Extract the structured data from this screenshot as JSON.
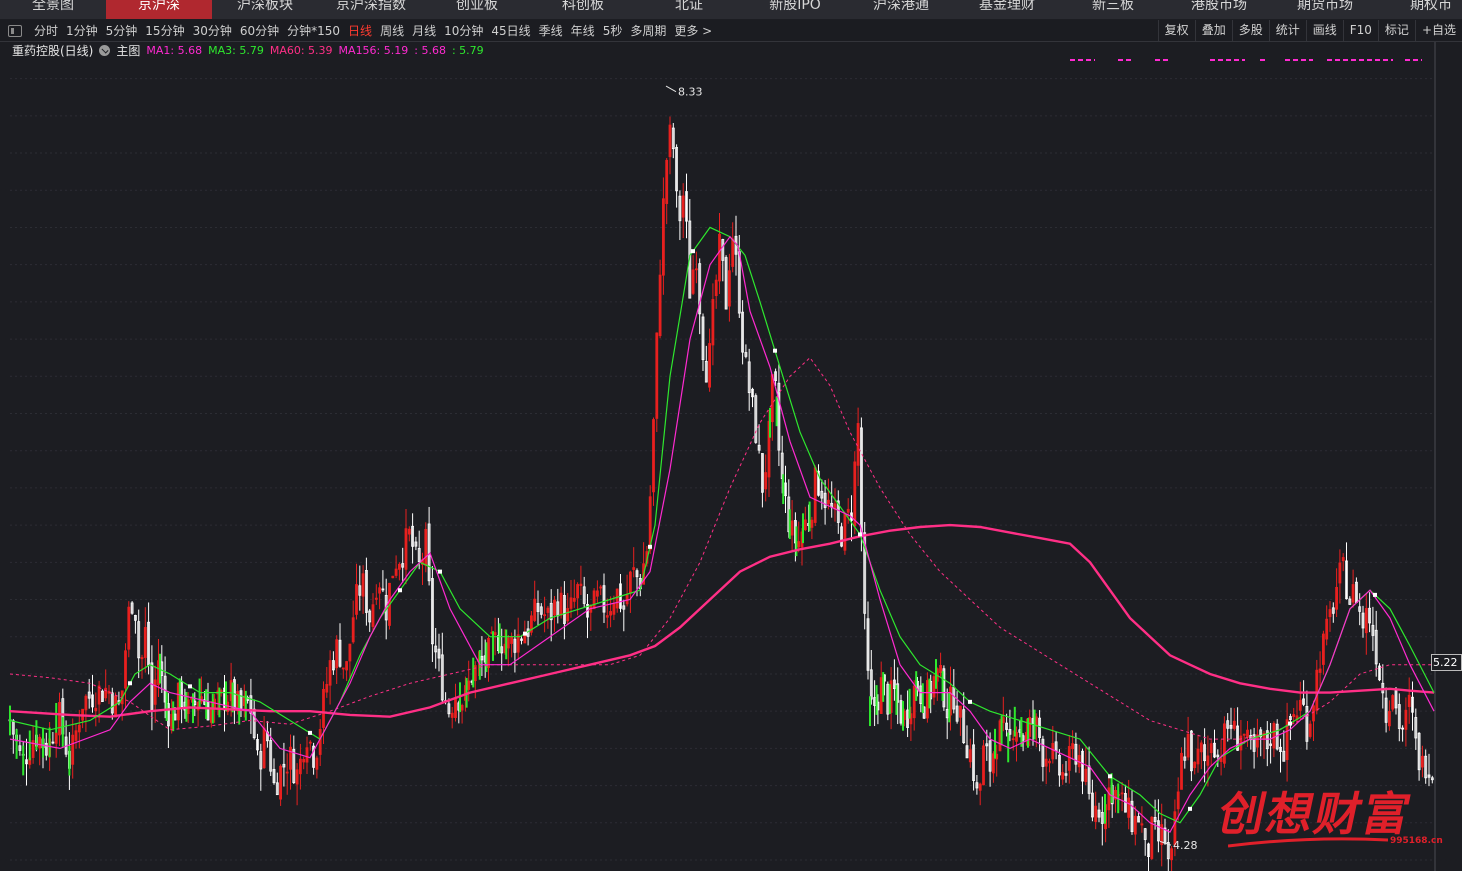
{
  "nav": {
    "tabs": [
      "全景图",
      "京沪深",
      "沪深板块",
      "京沪深指数",
      "创业板",
      "科创板",
      "北证",
      "新股IPO",
      "沪深港通",
      "基金理财",
      "新三板",
      "港股市场",
      "期货市场",
      "期权市"
    ],
    "active": 1
  },
  "toolbar": {
    "periods": [
      "分时",
      "1分钟",
      "5分钟",
      "15分钟",
      "30分钟",
      "60分钟",
      "分钟*150",
      "日线",
      "周线",
      "月线",
      "10分钟",
      "45日线",
      "季线",
      "年线",
      "5秒",
      "多周期",
      "更多 >"
    ],
    "active_period": "日线",
    "tools": [
      "复权",
      "叠加",
      "多股",
      "统计",
      "画线",
      "F10",
      "标记",
      "+自选"
    ]
  },
  "legend": {
    "title": "重药控股(日线)",
    "main": "主图",
    "items": [
      {
        "label": "MA1: 5.68",
        "color": "#ff2ad1"
      },
      {
        "label": "MA3: 5.79",
        "color": "#2ee82e"
      },
      {
        "label": "MA60: 5.39",
        "color": "#ff2f86"
      },
      {
        "label": "MA156: 5.19",
        "color": "#ff2ad1"
      },
      {
        "label": ": 5.68",
        "color": "#ff2ad1"
      },
      {
        "label": ": 5.79",
        "color": "#2ee82e"
      }
    ]
  },
  "price_tag": "5.22",
  "watermark": {
    "text": "创想财富",
    "url": "995168.cn"
  },
  "chart_data": {
    "type": "candlestick",
    "high_label": "8.33",
    "low_label": "4.28",
    "ylim": [
      4.2,
      8.5
    ],
    "last_close": 5.22,
    "colors": {
      "up": "#e8201f",
      "down": "#ffffff",
      "ma_fast": "#ff2ad1",
      "ma_mid": "#2ee82e",
      "ma_long": "#ff2f86",
      "ma_dash": "#ff2f86"
    },
    "close_path": [
      [
        0,
        4.95
      ],
      [
        12,
        4.72
      ],
      [
        25,
        4.88
      ],
      [
        38,
        4.8
      ],
      [
        48,
        5.0
      ],
      [
        60,
        4.72
      ],
      [
        72,
        5.05
      ],
      [
        85,
        5.1
      ],
      [
        98,
        5.12
      ],
      [
        108,
        5.0
      ],
      [
        112,
        5.1
      ],
      [
        118,
        5.5
      ],
      [
        124,
        5.65
      ],
      [
        130,
        5.2
      ],
      [
        136,
        5.45
      ],
      [
        142,
        5.0
      ],
      [
        148,
        5.3
      ],
      [
        155,
        5.05
      ],
      [
        162,
        4.95
      ],
      [
        170,
        5.1
      ],
      [
        180,
        4.98
      ],
      [
        190,
        5.1
      ],
      [
        200,
        5.0
      ],
      [
        210,
        5.05
      ],
      [
        220,
        5.1
      ],
      [
        230,
        5.0
      ],
      [
        240,
        5.05
      ],
      [
        248,
        4.7
      ],
      [
        256,
        4.9
      ],
      [
        264,
        4.6
      ],
      [
        272,
        4.7
      ],
      [
        280,
        4.75
      ],
      [
        288,
        4.65
      ],
      [
        296,
        4.9
      ],
      [
        305,
        4.75
      ],
      [
        312,
        5.0
      ],
      [
        320,
        5.25
      ],
      [
        328,
        5.35
      ],
      [
        336,
        5.2
      ],
      [
        344,
        5.55
      ],
      [
        352,
        5.7
      ],
      [
        360,
        5.5
      ],
      [
        368,
        5.75
      ],
      [
        376,
        5.55
      ],
      [
        384,
        5.8
      ],
      [
        392,
        5.85
      ],
      [
        400,
        5.95
      ],
      [
        408,
        5.75
      ],
      [
        416,
        5.9
      ],
      [
        422,
        5.4
      ],
      [
        430,
        5.2
      ],
      [
        438,
        5.0
      ],
      [
        446,
        5.1
      ],
      [
        454,
        5.05
      ],
      [
        462,
        5.2
      ],
      [
        470,
        5.25
      ],
      [
        478,
        5.3
      ],
      [
        488,
        5.4
      ],
      [
        498,
        5.35
      ],
      [
        508,
        5.4
      ],
      [
        518,
        5.45
      ],
      [
        528,
        5.55
      ],
      [
        538,
        5.5
      ],
      [
        548,
        5.6
      ],
      [
        558,
        5.5
      ],
      [
        568,
        5.65
      ],
      [
        578,
        5.5
      ],
      [
        588,
        5.6
      ],
      [
        598,
        5.55
      ],
      [
        606,
        5.65
      ],
      [
        614,
        5.55
      ],
      [
        622,
        5.75
      ],
      [
        630,
        5.7
      ],
      [
        638,
        5.9
      ],
      [
        644,
        6.6
      ],
      [
        650,
        7.4
      ],
      [
        656,
        7.95
      ],
      [
        662,
        8.15
      ],
      [
        668,
        7.6
      ],
      [
        674,
        7.8
      ],
      [
        680,
        7.25
      ],
      [
        686,
        7.5
      ],
      [
        692,
        7.0
      ],
      [
        698,
        6.8
      ],
      [
        704,
        7.2
      ],
      [
        710,
        7.5
      ],
      [
        716,
        7.2
      ],
      [
        722,
        7.6
      ],
      [
        728,
        7.3
      ],
      [
        734,
        6.9
      ],
      [
        740,
        6.7
      ],
      [
        746,
        6.5
      ],
      [
        752,
        6.2
      ],
      [
        758,
        6.4
      ],
      [
        764,
        6.85
      ],
      [
        770,
        6.3
      ],
      [
        776,
        6.1
      ],
      [
        782,
        5.95
      ],
      [
        788,
        5.9
      ],
      [
        794,
        6.0
      ],
      [
        800,
        6.05
      ],
      [
        806,
        6.25
      ],
      [
        812,
        6.2
      ],
      [
        818,
        6.1
      ],
      [
        824,
        6.05
      ],
      [
        830,
        5.95
      ],
      [
        836,
        6.0
      ],
      [
        842,
        6.1
      ],
      [
        848,
        6.55
      ],
      [
        854,
        5.5
      ],
      [
        860,
        5.0
      ],
      [
        866,
        5.05
      ],
      [
        872,
        5.15
      ],
      [
        878,
        5.05
      ],
      [
        884,
        5.1
      ],
      [
        890,
        5.0
      ],
      [
        896,
        4.95
      ],
      [
        902,
        5.1
      ],
      [
        908,
        5.15
      ],
      [
        914,
        5.05
      ],
      [
        920,
        5.1
      ],
      [
        926,
        5.2
      ],
      [
        932,
        5.15
      ],
      [
        938,
        5.0
      ],
      [
        944,
        5.1
      ],
      [
        950,
        4.95
      ],
      [
        956,
        4.85
      ],
      [
        962,
        4.75
      ],
      [
        968,
        4.5
      ],
      [
        974,
        4.8
      ],
      [
        980,
        4.7
      ],
      [
        986,
        4.85
      ],
      [
        992,
        4.9
      ],
      [
        998,
        4.8
      ],
      [
        1004,
        4.95
      ],
      [
        1010,
        4.9
      ],
      [
        1016,
        4.85
      ],
      [
        1022,
        4.95
      ],
      [
        1028,
        4.9
      ],
      [
        1034,
        4.75
      ],
      [
        1040,
        4.8
      ],
      [
        1046,
        4.7
      ],
      [
        1052,
        4.65
      ],
      [
        1058,
        4.7
      ],
      [
        1064,
        4.8
      ],
      [
        1070,
        4.75
      ],
      [
        1076,
        4.6
      ],
      [
        1082,
        4.45
      ],
      [
        1088,
        4.5
      ],
      [
        1094,
        4.45
      ],
      [
        1100,
        4.6
      ],
      [
        1106,
        4.55
      ],
      [
        1112,
        4.5
      ],
      [
        1118,
        4.45
      ],
      [
        1124,
        4.4
      ],
      [
        1130,
        4.45
      ],
      [
        1136,
        4.2
      ],
      [
        1142,
        4.35
      ],
      [
        1148,
        4.3
      ],
      [
        1154,
        4.35
      ],
      [
        1160,
        4.1
      ],
      [
        1166,
        4.45
      ],
      [
        1172,
        4.75
      ],
      [
        1178,
        4.85
      ],
      [
        1184,
        4.65
      ],
      [
        1190,
        4.8
      ],
      [
        1196,
        4.7
      ],
      [
        1202,
        4.9
      ],
      [
        1208,
        4.75
      ],
      [
        1214,
        4.85
      ],
      [
        1220,
        4.95
      ],
      [
        1226,
        4.85
      ],
      [
        1232,
        4.9
      ],
      [
        1238,
        4.8
      ],
      [
        1244,
        4.75
      ],
      [
        1250,
        4.85
      ],
      [
        1256,
        4.8
      ],
      [
        1262,
        4.9
      ],
      [
        1268,
        4.85
      ],
      [
        1274,
        4.8
      ],
      [
        1280,
        4.95
      ],
      [
        1286,
        5.0
      ],
      [
        1292,
        5.05
      ],
      [
        1298,
        4.9
      ],
      [
        1304,
        5.1
      ],
      [
        1310,
        5.3
      ],
      [
        1316,
        5.4
      ],
      [
        1322,
        5.55
      ],
      [
        1328,
        5.7
      ],
      [
        1334,
        5.75
      ],
      [
        1340,
        5.6
      ],
      [
        1346,
        5.65
      ],
      [
        1352,
        5.45
      ],
      [
        1358,
        5.55
      ],
      [
        1364,
        5.4
      ],
      [
        1370,
        5.2
      ],
      [
        1376,
        5.0
      ],
      [
        1382,
        5.15
      ],
      [
        1388,
        4.95
      ],
      [
        1394,
        4.9
      ],
      [
        1400,
        5.05
      ],
      [
        1406,
        4.8
      ],
      [
        1412,
        4.7
      ],
      [
        1418,
        4.75
      ],
      [
        1424,
        4.65
      ]
    ],
    "ma_fast_path": [
      [
        0,
        4.85
      ],
      [
        50,
        4.8
      ],
      [
        100,
        4.9
      ],
      [
        120,
        5.05
      ],
      [
        140,
        5.15
      ],
      [
        160,
        5.1
      ],
      [
        200,
        5.05
      ],
      [
        240,
        5.0
      ],
      [
        270,
        4.8
      ],
      [
        300,
        4.75
      ],
      [
        320,
        4.95
      ],
      [
        340,
        5.15
      ],
      [
        360,
        5.4
      ],
      [
        380,
        5.6
      ],
      [
        400,
        5.75
      ],
      [
        420,
        5.85
      ],
      [
        440,
        5.55
      ],
      [
        470,
        5.25
      ],
      [
        500,
        5.25
      ],
      [
        540,
        5.4
      ],
      [
        580,
        5.55
      ],
      [
        620,
        5.6
      ],
      [
        640,
        5.75
      ],
      [
        660,
        6.3
      ],
      [
        680,
        7.0
      ],
      [
        700,
        7.4
      ],
      [
        720,
        7.55
      ],
      [
        728,
        7.5
      ],
      [
        740,
        7.15
      ],
      [
        760,
        6.85
      ],
      [
        780,
        6.45
      ],
      [
        800,
        6.15
      ],
      [
        820,
        6.1
      ],
      [
        840,
        6.05
      ],
      [
        850,
        6.0
      ],
      [
        870,
        5.6
      ],
      [
        890,
        5.25
      ],
      [
        910,
        5.1
      ],
      [
        940,
        5.1
      ],
      [
        960,
        5.0
      ],
      [
        980,
        4.85
      ],
      [
        1000,
        4.8
      ],
      [
        1020,
        4.85
      ],
      [
        1040,
        4.8
      ],
      [
        1060,
        4.75
      ],
      [
        1080,
        4.7
      ],
      [
        1100,
        4.55
      ],
      [
        1120,
        4.5
      ],
      [
        1140,
        4.4
      ],
      [
        1160,
        4.35
      ],
      [
        1180,
        4.55
      ],
      [
        1200,
        4.7
      ],
      [
        1220,
        4.8
      ],
      [
        1240,
        4.85
      ],
      [
        1260,
        4.85
      ],
      [
        1280,
        4.9
      ],
      [
        1300,
        5.0
      ],
      [
        1320,
        5.25
      ],
      [
        1340,
        5.55
      ],
      [
        1360,
        5.65
      ],
      [
        1380,
        5.5
      ],
      [
        1400,
        5.25
      ],
      [
        1424,
        5.0
      ]
    ],
    "ma_mid_path": [
      [
        0,
        4.95
      ],
      [
        40,
        4.9
      ],
      [
        80,
        4.95
      ],
      [
        110,
        5.05
      ],
      [
        125,
        5.2
      ],
      [
        140,
        5.25
      ],
      [
        160,
        5.2
      ],
      [
        190,
        5.1
      ],
      [
        220,
        5.1
      ],
      [
        250,
        5.05
      ],
      [
        280,
        4.95
      ],
      [
        310,
        4.85
      ],
      [
        330,
        5.05
      ],
      [
        350,
        5.3
      ],
      [
        370,
        5.5
      ],
      [
        390,
        5.65
      ],
      [
        410,
        5.8
      ],
      [
        430,
        5.75
      ],
      [
        450,
        5.55
      ],
      [
        480,
        5.4
      ],
      [
        510,
        5.4
      ],
      [
        540,
        5.5
      ],
      [
        570,
        5.55
      ],
      [
        600,
        5.6
      ],
      [
        630,
        5.65
      ],
      [
        645,
        6.0
      ],
      [
        660,
        6.8
      ],
      [
        680,
        7.45
      ],
      [
        700,
        7.6
      ],
      [
        720,
        7.55
      ],
      [
        735,
        7.45
      ],
      [
        750,
        7.2
      ],
      [
        770,
        6.85
      ],
      [
        790,
        6.5
      ],
      [
        810,
        6.25
      ],
      [
        830,
        6.1
      ],
      [
        850,
        5.95
      ],
      [
        870,
        5.65
      ],
      [
        890,
        5.4
      ],
      [
        910,
        5.25
      ],
      [
        940,
        5.15
      ],
      [
        960,
        5.05
      ],
      [
        980,
        5.0
      ],
      [
        1010,
        4.95
      ],
      [
        1040,
        4.9
      ],
      [
        1070,
        4.85
      ],
      [
        1100,
        4.65
      ],
      [
        1130,
        4.55
      ],
      [
        1150,
        4.45
      ],
      [
        1170,
        4.4
      ],
      [
        1190,
        4.55
      ],
      [
        1210,
        4.75
      ],
      [
        1240,
        4.85
      ],
      [
        1270,
        4.9
      ],
      [
        1300,
        5.0
      ],
      [
        1320,
        5.25
      ],
      [
        1340,
        5.55
      ],
      [
        1360,
        5.65
      ],
      [
        1380,
        5.55
      ],
      [
        1400,
        5.35
      ],
      [
        1424,
        5.1
      ]
    ],
    "ma_long_path": [
      [
        0,
        5.0
      ],
      [
        60,
        4.98
      ],
      [
        100,
        4.97
      ],
      [
        140,
        5.0
      ],
      [
        180,
        5.02
      ],
      [
        220,
        5.01
      ],
      [
        260,
        5.0
      ],
      [
        300,
        5.0
      ],
      [
        340,
        4.98
      ],
      [
        380,
        4.97
      ],
      [
        420,
        5.02
      ],
      [
        460,
        5.1
      ],
      [
        500,
        5.15
      ],
      [
        540,
        5.2
      ],
      [
        580,
        5.25
      ],
      [
        620,
        5.3
      ],
      [
        645,
        5.35
      ],
      [
        670,
        5.45
      ],
      [
        700,
        5.6
      ],
      [
        730,
        5.75
      ],
      [
        760,
        5.83
      ],
      [
        790,
        5.87
      ],
      [
        820,
        5.9
      ],
      [
        850,
        5.94
      ],
      [
        880,
        5.97
      ],
      [
        910,
        5.99
      ],
      [
        940,
        6.0
      ],
      [
        970,
        5.99
      ],
      [
        1000,
        5.96
      ],
      [
        1030,
        5.93
      ],
      [
        1060,
        5.9
      ],
      [
        1080,
        5.8
      ],
      [
        1100,
        5.65
      ],
      [
        1120,
        5.5
      ],
      [
        1140,
        5.4
      ],
      [
        1160,
        5.3
      ],
      [
        1180,
        5.25
      ],
      [
        1200,
        5.2
      ],
      [
        1230,
        5.15
      ],
      [
        1260,
        5.12
      ],
      [
        1290,
        5.1
      ],
      [
        1320,
        5.1
      ],
      [
        1350,
        5.11
      ],
      [
        1380,
        5.12
      ],
      [
        1400,
        5.11
      ],
      [
        1424,
        5.1
      ]
    ],
    "ma_dash_path": [
      [
        0,
        5.2
      ],
      [
        40,
        5.18
      ],
      [
        80,
        5.15
      ],
      [
        120,
        5.05
      ],
      [
        160,
        4.9
      ],
      [
        200,
        4.92
      ],
      [
        240,
        4.95
      ],
      [
        280,
        4.93
      ],
      [
        320,
        5.0
      ],
      [
        360,
        5.08
      ],
      [
        400,
        5.15
      ],
      [
        440,
        5.2
      ],
      [
        480,
        5.25
      ],
      [
        520,
        5.25
      ],
      [
        560,
        5.25
      ],
      [
        600,
        5.25
      ],
      [
        630,
        5.3
      ],
      [
        660,
        5.5
      ],
      [
        690,
        5.8
      ],
      [
        720,
        6.2
      ],
      [
        750,
        6.55
      ],
      [
        780,
        6.8
      ],
      [
        800,
        6.9
      ],
      [
        820,
        6.75
      ],
      [
        840,
        6.5
      ],
      [
        870,
        6.2
      ],
      [
        900,
        5.95
      ],
      [
        930,
        5.75
      ],
      [
        960,
        5.6
      ],
      [
        990,
        5.45
      ],
      [
        1020,
        5.35
      ],
      [
        1050,
        5.25
      ],
      [
        1080,
        5.15
      ],
      [
        1110,
        5.05
      ],
      [
        1140,
        4.95
      ],
      [
        1170,
        4.9
      ],
      [
        1200,
        4.85
      ],
      [
        1230,
        4.85
      ],
      [
        1260,
        4.88
      ],
      [
        1290,
        4.95
      ],
      [
        1320,
        5.05
      ],
      [
        1350,
        5.2
      ],
      [
        1380,
        5.25
      ],
      [
        1400,
        5.25
      ],
      [
        1424,
        5.25
      ]
    ]
  }
}
